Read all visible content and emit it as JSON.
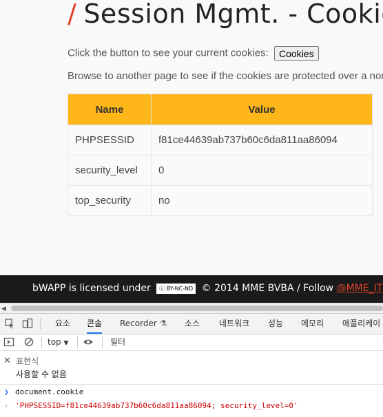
{
  "page": {
    "title_mark": "/",
    "title": "Session Mgmt. - Cookies",
    "instruction_text": "Click the button to see your current cookies:",
    "cookies_button": "Cookies",
    "browse_text": "Browse to another page to see if the cookies are protected over a non",
    "table": {
      "headers": [
        "Name",
        "Value"
      ],
      "rows": [
        {
          "name": "PHPSESSID",
          "value": "f81ce44639ab737b60c6da811aa86094"
        },
        {
          "name": "security_level",
          "value": "0"
        },
        {
          "name": "top_security",
          "value": "no"
        }
      ]
    },
    "accent_color": "#ffb619"
  },
  "footer": {
    "licensed_text": "bWAPP is licensed under",
    "cc_badge": "BY-NC-ND",
    "copyright_text": "© 2014 MME BVBA / Follow",
    "twitter_link": "@MME_IT"
  },
  "devtools": {
    "tabs": [
      "요소",
      "콘솔",
      "Recorder",
      "소스",
      "네트워크",
      "성능",
      "메모리",
      "애플리케이"
    ],
    "active_tab": "콘솔",
    "context_select": "top",
    "filter_placeholder": "필터",
    "expression": {
      "title": "표현식",
      "value": "사용할 수 없음"
    },
    "input_line": "document.cookie",
    "output_line": "'PHPSESSID=f81ce44639ab737b60c6da811aa86094; security_level=0'"
  }
}
